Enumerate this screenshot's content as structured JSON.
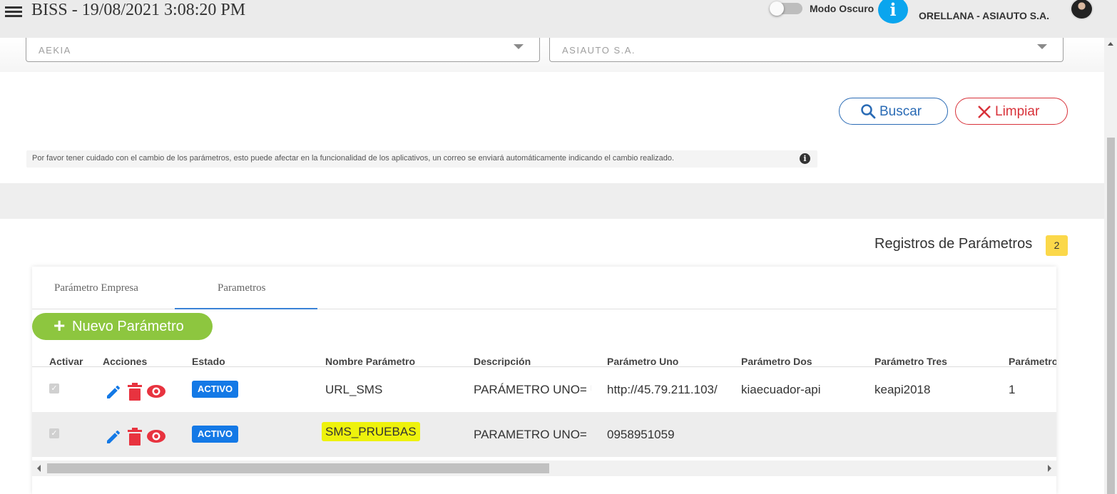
{
  "header": {
    "title": "BISS - 19/08/2021 3:08:20 PM",
    "dark_mode_label": "Modo Oscuro",
    "info_icon": "info-icon",
    "company_user": "ORELLANA - ASIAUTO S.A."
  },
  "filters": {
    "brand": "AEKIA",
    "company": "ASIAUTO S.A."
  },
  "actions": {
    "search_label": "Buscar",
    "clear_label": "Limpiar"
  },
  "note": "Por favor tener cuidado con el cambio de los parámetros, esto puede afectar en la funcionalidad de los aplicativos, un correo se enviará automáticamente indicando el cambio realizado.",
  "records": {
    "title": "Registros de Parámetros",
    "count": "2"
  },
  "tabs": [
    {
      "label": "Parámetro Empresa",
      "active": false
    },
    {
      "label": "Parametros",
      "active": true
    }
  ],
  "new_button": {
    "icon": "+",
    "label": "Nuevo Parámetro"
  },
  "table": {
    "columns": [
      "Activar",
      "Acciones",
      "Estado",
      "Nombre Parámetro",
      "Descripción",
      "Parámetro Uno",
      "Parámetro Dos",
      "Parámetro Tres",
      "Parámetro"
    ],
    "rows": [
      {
        "active": true,
        "estado": "ACTIVO",
        "nombre": "URL_SMS",
        "descripcion": "PARÁMETRO UNO= U",
        "param_uno": "http://45.79.211.103/",
        "param_dos": "kiaecuador-api",
        "param_tres": "keapi2018",
        "param_cuatro": "1",
        "highlighted": false
      },
      {
        "active": true,
        "estado": "ACTIVO",
        "nombre": "SMS_PRUEBAS",
        "descripcion": "PARAMETRO UNO= N",
        "param_uno": "0958951059",
        "param_dos": "",
        "param_tres": "",
        "param_cuatro": "",
        "highlighted": true
      }
    ]
  },
  "colors": {
    "accent_blue": "#2a6bb5",
    "danger_red": "#d8323a",
    "success_green": "#8dc63f",
    "badge_blue": "#1479e6",
    "badge_yellow": "#fbd84a",
    "highlight": "#eef20c"
  }
}
